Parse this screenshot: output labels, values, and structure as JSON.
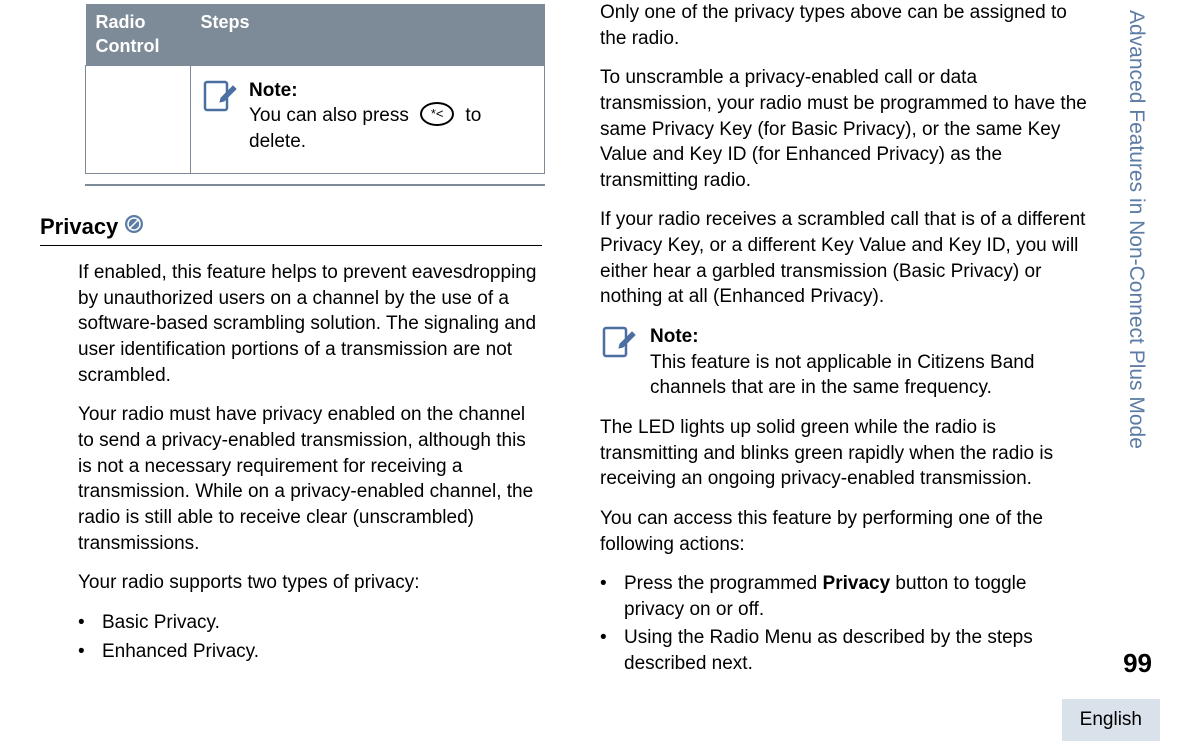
{
  "sidebar": {
    "title": "Advanced Features in Non-Connect Plus Mode",
    "pageNum": "99",
    "lang": "English"
  },
  "table": {
    "h1": "Radio Control",
    "h2": "Steps",
    "noteLabel": "Note:",
    "noteText1": "You can also press ",
    "noteText2": " to delete.",
    "keyGlyph": "*<"
  },
  "section": {
    "heading": "Privacy"
  },
  "left": {
    "p1": "If enabled, this feature helps to prevent eavesdropping by unauthorized users on a channel by the use of a software-based scrambling solution. The signaling and user identification portions of a transmission are not scrambled.",
    "p2": "Your radio must have privacy enabled on the channel to send a privacy-enabled transmission, although this is not a necessary requirement for receiving a transmission. While on a privacy-enabled channel, the radio is still able to receive clear (unscrambled) transmissions.",
    "p3": "Your radio supports two types of privacy:",
    "li1": "Basic Privacy.",
    "li2": "Enhanced Privacy."
  },
  "right": {
    "p1": "Only one of the privacy types above can be assigned to the radio.",
    "p2": "To unscramble a privacy-enabled call or data transmission, your radio must be programmed to have the same Privacy Key (for Basic Privacy), or the same Key Value and Key ID (for Enhanced Privacy) as the transmitting radio.",
    "p3": "If your radio receives a scrambled call that is of a different Privacy Key, or a different Key Value and Key ID, you will either hear a garbled transmission (Basic Privacy) or nothing at all (Enhanced Privacy).",
    "noteLabel": "Note:",
    "noteText": "This feature is not applicable in Citizens Band channels that are in the same frequency.",
    "p4": "The LED lights up solid green while the radio is transmitting and blinks green rapidly when the radio is receiving an ongoing privacy-enabled transmission.",
    "p5": "You can access this feature by performing one of the following actions:",
    "li1a": "Press the programmed ",
    "li1bold": "Privacy",
    "li1b": " button to toggle privacy on or off.",
    "li2": "Using the Radio Menu as described by the steps described next."
  }
}
